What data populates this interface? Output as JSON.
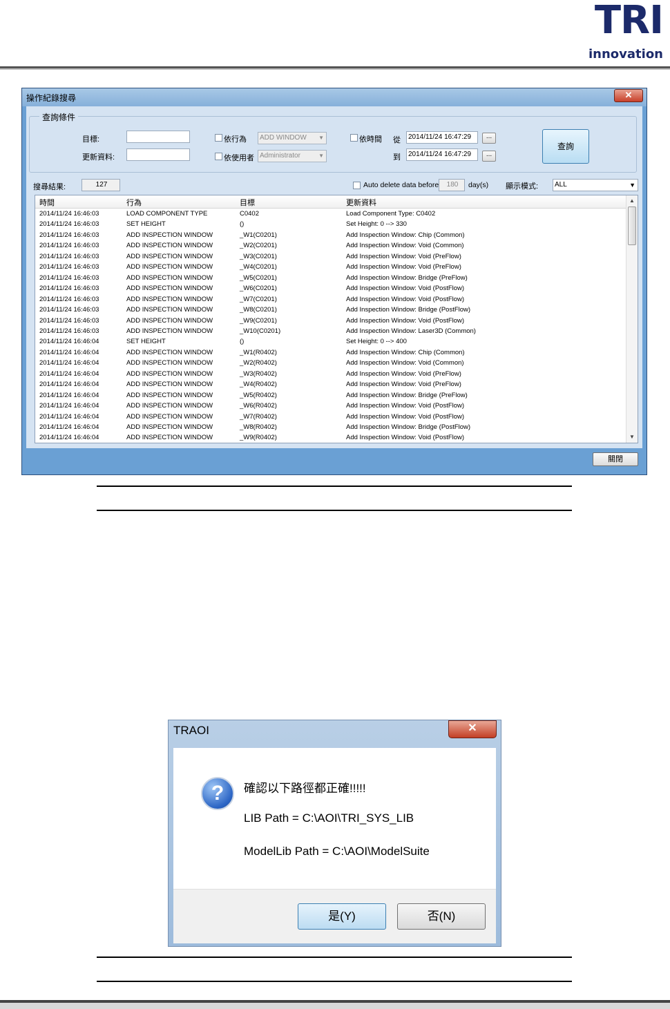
{
  "logo": {
    "main": "TRI",
    "sub": "innovation"
  },
  "log_window": {
    "title": "操作紀錄搜尋",
    "close_glyph": "✕",
    "group_title": "查詢條件",
    "target_label": "目標:",
    "update_label": "更新資料:",
    "by_action_label": "依行為",
    "action_value": "ADD WINDOW",
    "by_user_label": "依使用者",
    "user_value": "Administrator",
    "by_time_label": "依時間",
    "from_label": "從",
    "from_value": "2014/11/24 16:47:29",
    "to_label": "到",
    "to_value": "2014/11/24 16:47:29",
    "ellipsis": "...",
    "query_button": "查詢",
    "result_label": "搜尋結果:",
    "result_count": "127",
    "auto_delete_label": "Auto delete data before",
    "auto_delete_days": "180",
    "days_unit": "day(s)",
    "display_mode_label": "顯示模式:",
    "display_mode_value": "ALL",
    "columns": [
      "時間",
      "行為",
      "目標",
      "更新資料"
    ],
    "rows": [
      [
        "2014/11/24 16:46:03",
        "LOAD COMPONENT TYPE",
        "C0402",
        "Load Component Type: C0402"
      ],
      [
        "2014/11/24 16:46:03",
        "SET HEIGHT",
        "()",
        "Set Height: 0 --> 330"
      ],
      [
        "2014/11/24 16:46:03",
        "ADD INSPECTION WINDOW",
        "_W1(C0201)",
        "Add Inspection Window: Chip (Common)"
      ],
      [
        "2014/11/24 16:46:03",
        "ADD INSPECTION WINDOW",
        "_W2(C0201)",
        "Add Inspection Window: Void (Common)"
      ],
      [
        "2014/11/24 16:46:03",
        "ADD INSPECTION WINDOW",
        "_W3(C0201)",
        "Add Inspection Window: Void (PreFlow)"
      ],
      [
        "2014/11/24 16:46:03",
        "ADD INSPECTION WINDOW",
        "_W4(C0201)",
        "Add Inspection Window: Void (PreFlow)"
      ],
      [
        "2014/11/24 16:46:03",
        "ADD INSPECTION WINDOW",
        "_W5(C0201)",
        "Add Inspection Window: Bridge (PreFlow)"
      ],
      [
        "2014/11/24 16:46:03",
        "ADD INSPECTION WINDOW",
        "_W6(C0201)",
        "Add Inspection Window: Void (PostFlow)"
      ],
      [
        "2014/11/24 16:46:03",
        "ADD INSPECTION WINDOW",
        "_W7(C0201)",
        "Add Inspection Window: Void (PostFlow)"
      ],
      [
        "2014/11/24 16:46:03",
        "ADD INSPECTION WINDOW",
        "_W8(C0201)",
        "Add Inspection Window: Bridge (PostFlow)"
      ],
      [
        "2014/11/24 16:46:03",
        "ADD INSPECTION WINDOW",
        "_W9(C0201)",
        "Add Inspection Window: Void (PostFlow)"
      ],
      [
        "2014/11/24 16:46:03",
        "ADD INSPECTION WINDOW",
        "_W10(C0201)",
        "Add Inspection Window: Laser3D (Common)"
      ],
      [
        "2014/11/24 16:46:04",
        "SET HEIGHT",
        "()",
        "Set Height: 0 --> 400"
      ],
      [
        "2014/11/24 16:46:04",
        "ADD INSPECTION WINDOW",
        "_W1(R0402)",
        "Add Inspection Window: Chip (Common)"
      ],
      [
        "2014/11/24 16:46:04",
        "ADD INSPECTION WINDOW",
        "_W2(R0402)",
        "Add Inspection Window: Void (Common)"
      ],
      [
        "2014/11/24 16:46:04",
        "ADD INSPECTION WINDOW",
        "_W3(R0402)",
        "Add Inspection Window: Void (PreFlow)"
      ],
      [
        "2014/11/24 16:46:04",
        "ADD INSPECTION WINDOW",
        "_W4(R0402)",
        "Add Inspection Window: Void (PreFlow)"
      ],
      [
        "2014/11/24 16:46:04",
        "ADD INSPECTION WINDOW",
        "_W5(R0402)",
        "Add Inspection Window: Bridge (PreFlow)"
      ],
      [
        "2014/11/24 16:46:04",
        "ADD INSPECTION WINDOW",
        "_W6(R0402)",
        "Add Inspection Window: Void (PostFlow)"
      ],
      [
        "2014/11/24 16:46:04",
        "ADD INSPECTION WINDOW",
        "_W7(R0402)",
        "Add Inspection Window: Void (PostFlow)"
      ],
      [
        "2014/11/24 16:46:04",
        "ADD INSPECTION WINDOW",
        "_W8(R0402)",
        "Add Inspection Window: Bridge (PostFlow)"
      ],
      [
        "2014/11/24 16:46:04",
        "ADD INSPECTION WINDOW",
        "_W9(R0402)",
        "Add Inspection Window: Void (PostFlow)"
      ]
    ],
    "close_button": "關閉"
  },
  "dialog": {
    "title": "TRAOI",
    "close_glyph": "✕",
    "icon": "question-icon",
    "icon_glyph": "?",
    "line1": "確認以下路徑都正確!!!!!",
    "line2": "LIB Path = C:\\AOI\\TRI_SYS_LIB",
    "line3": "ModelLib Path = C:\\AOI\\ModelSuite",
    "yes_button": "是(Y)",
    "no_button": "否(N)"
  }
}
